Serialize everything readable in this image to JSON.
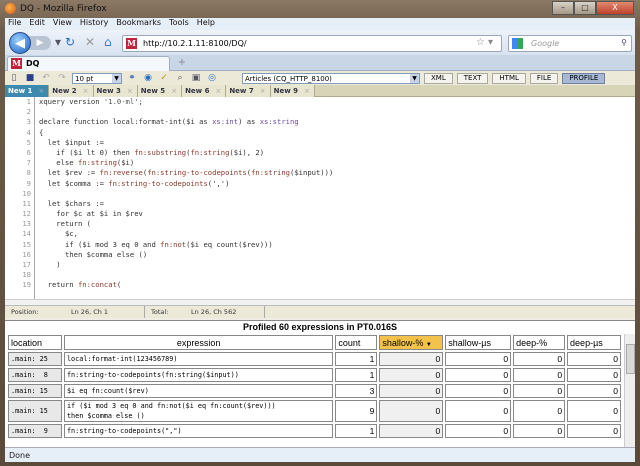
{
  "window": {
    "title": "DQ - Mozilla Firefox",
    "controls": [
      "–",
      "□",
      "X"
    ]
  },
  "menu": [
    "File",
    "Edit",
    "View",
    "History",
    "Bookmarks",
    "Tools",
    "Help"
  ],
  "nav": {
    "url": "http://10.2.1.11:8100/DQ/",
    "search_placeholder": "Google"
  },
  "browser_tab": {
    "label": "DQ",
    "new_tab": "+"
  },
  "toolbar": {
    "font_size": "10 pt",
    "database": "Articles (CQ_HTTP_8100)",
    "modes": [
      "XML",
      "TEXT",
      "HTML",
      "FILE",
      "PROFILE"
    ],
    "active_mode": "PROFILE"
  },
  "doc_tabs": [
    "New 1",
    "New 2",
    "New 3",
    "New 5",
    "New 6",
    "New 7",
    "New 9"
  ],
  "active_doc_tab": "New 1",
  "editor": {
    "lines": [
      [
        [
          "xquery version ",
          "k"
        ],
        [
          "'1.0-ml'",
          "s"
        ],
        [
          ";",
          "k"
        ]
      ],
      [],
      [
        [
          "declare function local:format-int($i as ",
          "k"
        ],
        [
          "xs:int",
          "t"
        ],
        [
          ") as ",
          "k"
        ],
        [
          "xs:string",
          "t"
        ]
      ],
      [
        [
          "{",
          "k"
        ]
      ],
      [
        [
          "  let $input :=",
          "k"
        ]
      ],
      [
        [
          "    if ($i lt 0) then ",
          "k"
        ],
        [
          "fn:substring",
          "f"
        ],
        [
          "(",
          "k"
        ],
        [
          "fn:string",
          "f"
        ],
        [
          "($i), 2)",
          "k"
        ]
      ],
      [
        [
          "    else ",
          "k"
        ],
        [
          "fn:string",
          "f"
        ],
        [
          "($i)",
          "k"
        ]
      ],
      [
        [
          "  let $rev := ",
          "k"
        ],
        [
          "fn:reverse",
          "f"
        ],
        [
          "(",
          "k"
        ],
        [
          "fn:string-to-codepoints",
          "f"
        ],
        [
          "(",
          "k"
        ],
        [
          "fn:string",
          "f"
        ],
        [
          "($input)))",
          "k"
        ]
      ],
      [
        [
          "  let $comma := ",
          "k"
        ],
        [
          "fn:string-to-codepoints",
          "f"
        ],
        [
          "(',')",
          "k"
        ]
      ],
      [],
      [
        [
          "  let $chars :=",
          "k"
        ]
      ],
      [
        [
          "    for $c at $i in $rev",
          "k"
        ]
      ],
      [
        [
          "    return (",
          "k"
        ]
      ],
      [
        [
          "      $c,",
          "k"
        ]
      ],
      [
        [
          "      if ($i mod 3 eq 0 and ",
          "k"
        ],
        [
          "fn:not",
          "f"
        ],
        [
          "($i eq count($rev)))",
          "k"
        ]
      ],
      [
        [
          "      then $comma else ()",
          "k"
        ]
      ],
      [
        [
          "    )",
          "k"
        ]
      ],
      [],
      [
        [
          "  return ",
          "k"
        ],
        [
          "fn:concat",
          "f"
        ],
        [
          "(",
          "k"
        ]
      ]
    ]
  },
  "position": {
    "label": "Position:",
    "value": "Ln 26, Ch 1",
    "total_label": "Total:",
    "total_value": "Ln 26, Ch 562"
  },
  "profile": {
    "title": "Profiled 60 expressions in PT0.016S",
    "columns": [
      "location",
      "expression",
      "count",
      "shallow-%",
      "shallow-µs",
      "deep-%",
      "deep-µs"
    ],
    "sorted_column": "shallow-%",
    "rows": [
      {
        "location": ".main: 25",
        "expression": "local:format-int(123456789)",
        "count": "1",
        "shallow_pct": "0",
        "shallow_us": "0",
        "deep_pct": "0",
        "deep_us": "0"
      },
      {
        "location": ".main:  8",
        "expression": "fn:string-to-codepoints(fn:string($input))",
        "count": "1",
        "shallow_pct": "0",
        "shallow_us": "0",
        "deep_pct": "0",
        "deep_us": "0"
      },
      {
        "location": ".main: 15",
        "expression": "$i eq fn:count($rev)",
        "count": "3",
        "shallow_pct": "0",
        "shallow_us": "0",
        "deep_pct": "0",
        "deep_us": "0"
      },
      {
        "location": ".main: 15",
        "expression": "if ($i mod 3 eq 0 and fn:not($i eq fn:count($rev)))\nthen $comma else ()",
        "count": "9",
        "shallow_pct": "0",
        "shallow_us": "0",
        "deep_pct": "0",
        "deep_us": "0"
      },
      {
        "location": ".main:  9",
        "expression": "fn:string-to-codepoints(\",\")",
        "count": "1",
        "shallow_pct": "0",
        "shallow_us": "0",
        "deep_pct": "0",
        "deep_us": "0"
      }
    ]
  },
  "status": "Done"
}
